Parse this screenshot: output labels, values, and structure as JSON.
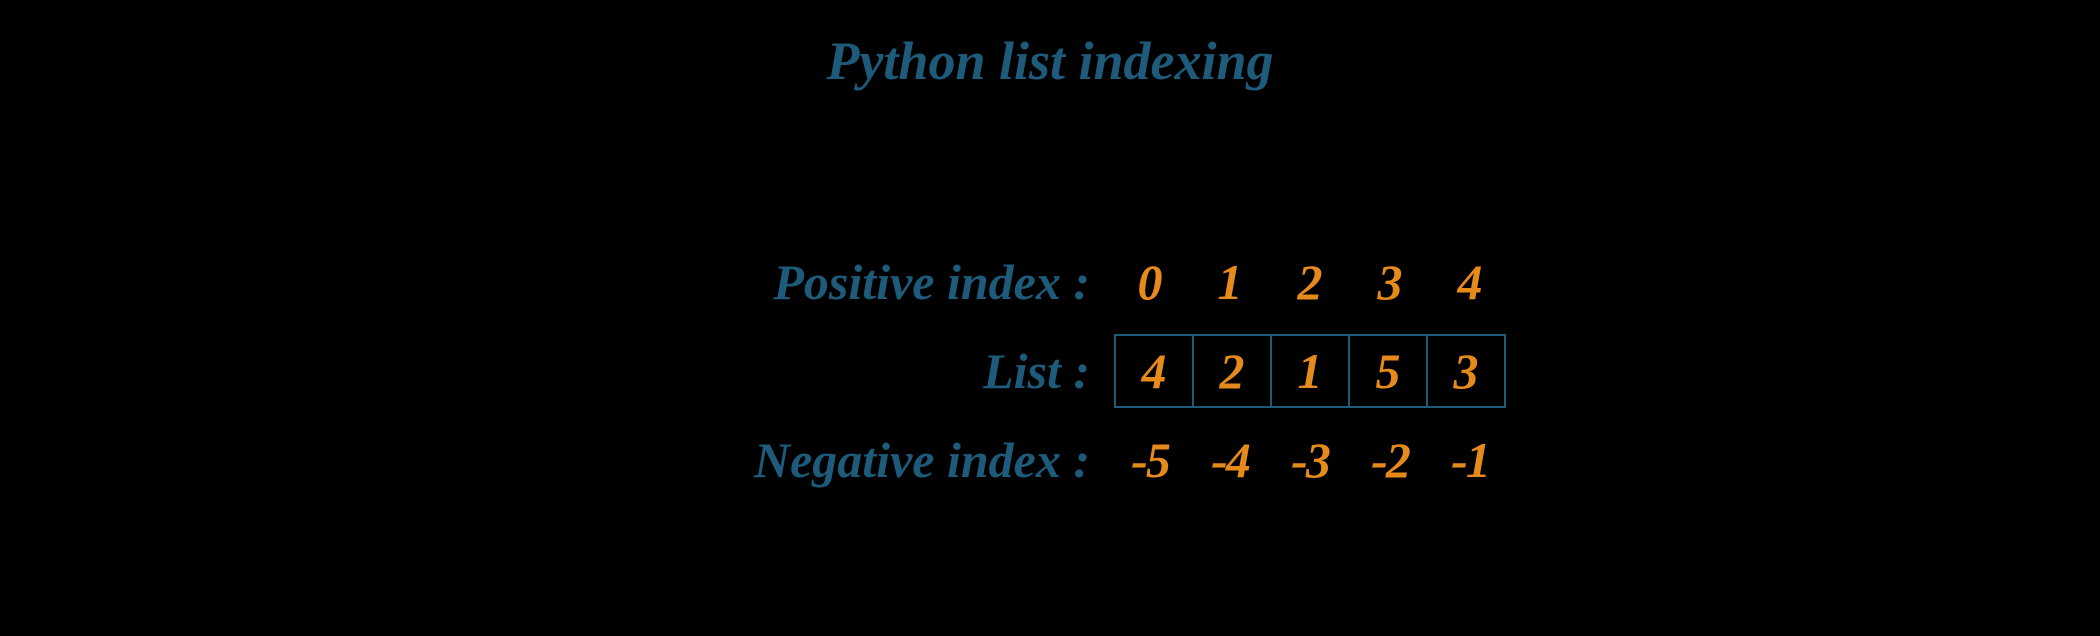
{
  "title": "Python list indexing",
  "rows": {
    "positive": {
      "label": "Positive index :",
      "values": [
        "0",
        "1",
        "2",
        "3",
        "4"
      ]
    },
    "list": {
      "label": "List :",
      "values": [
        "4",
        "2",
        "1",
        "5",
        "3"
      ]
    },
    "negative": {
      "label": "Negative index :",
      "values": [
        "-5",
        "-4",
        "-3",
        "-2",
        "-1"
      ]
    }
  }
}
